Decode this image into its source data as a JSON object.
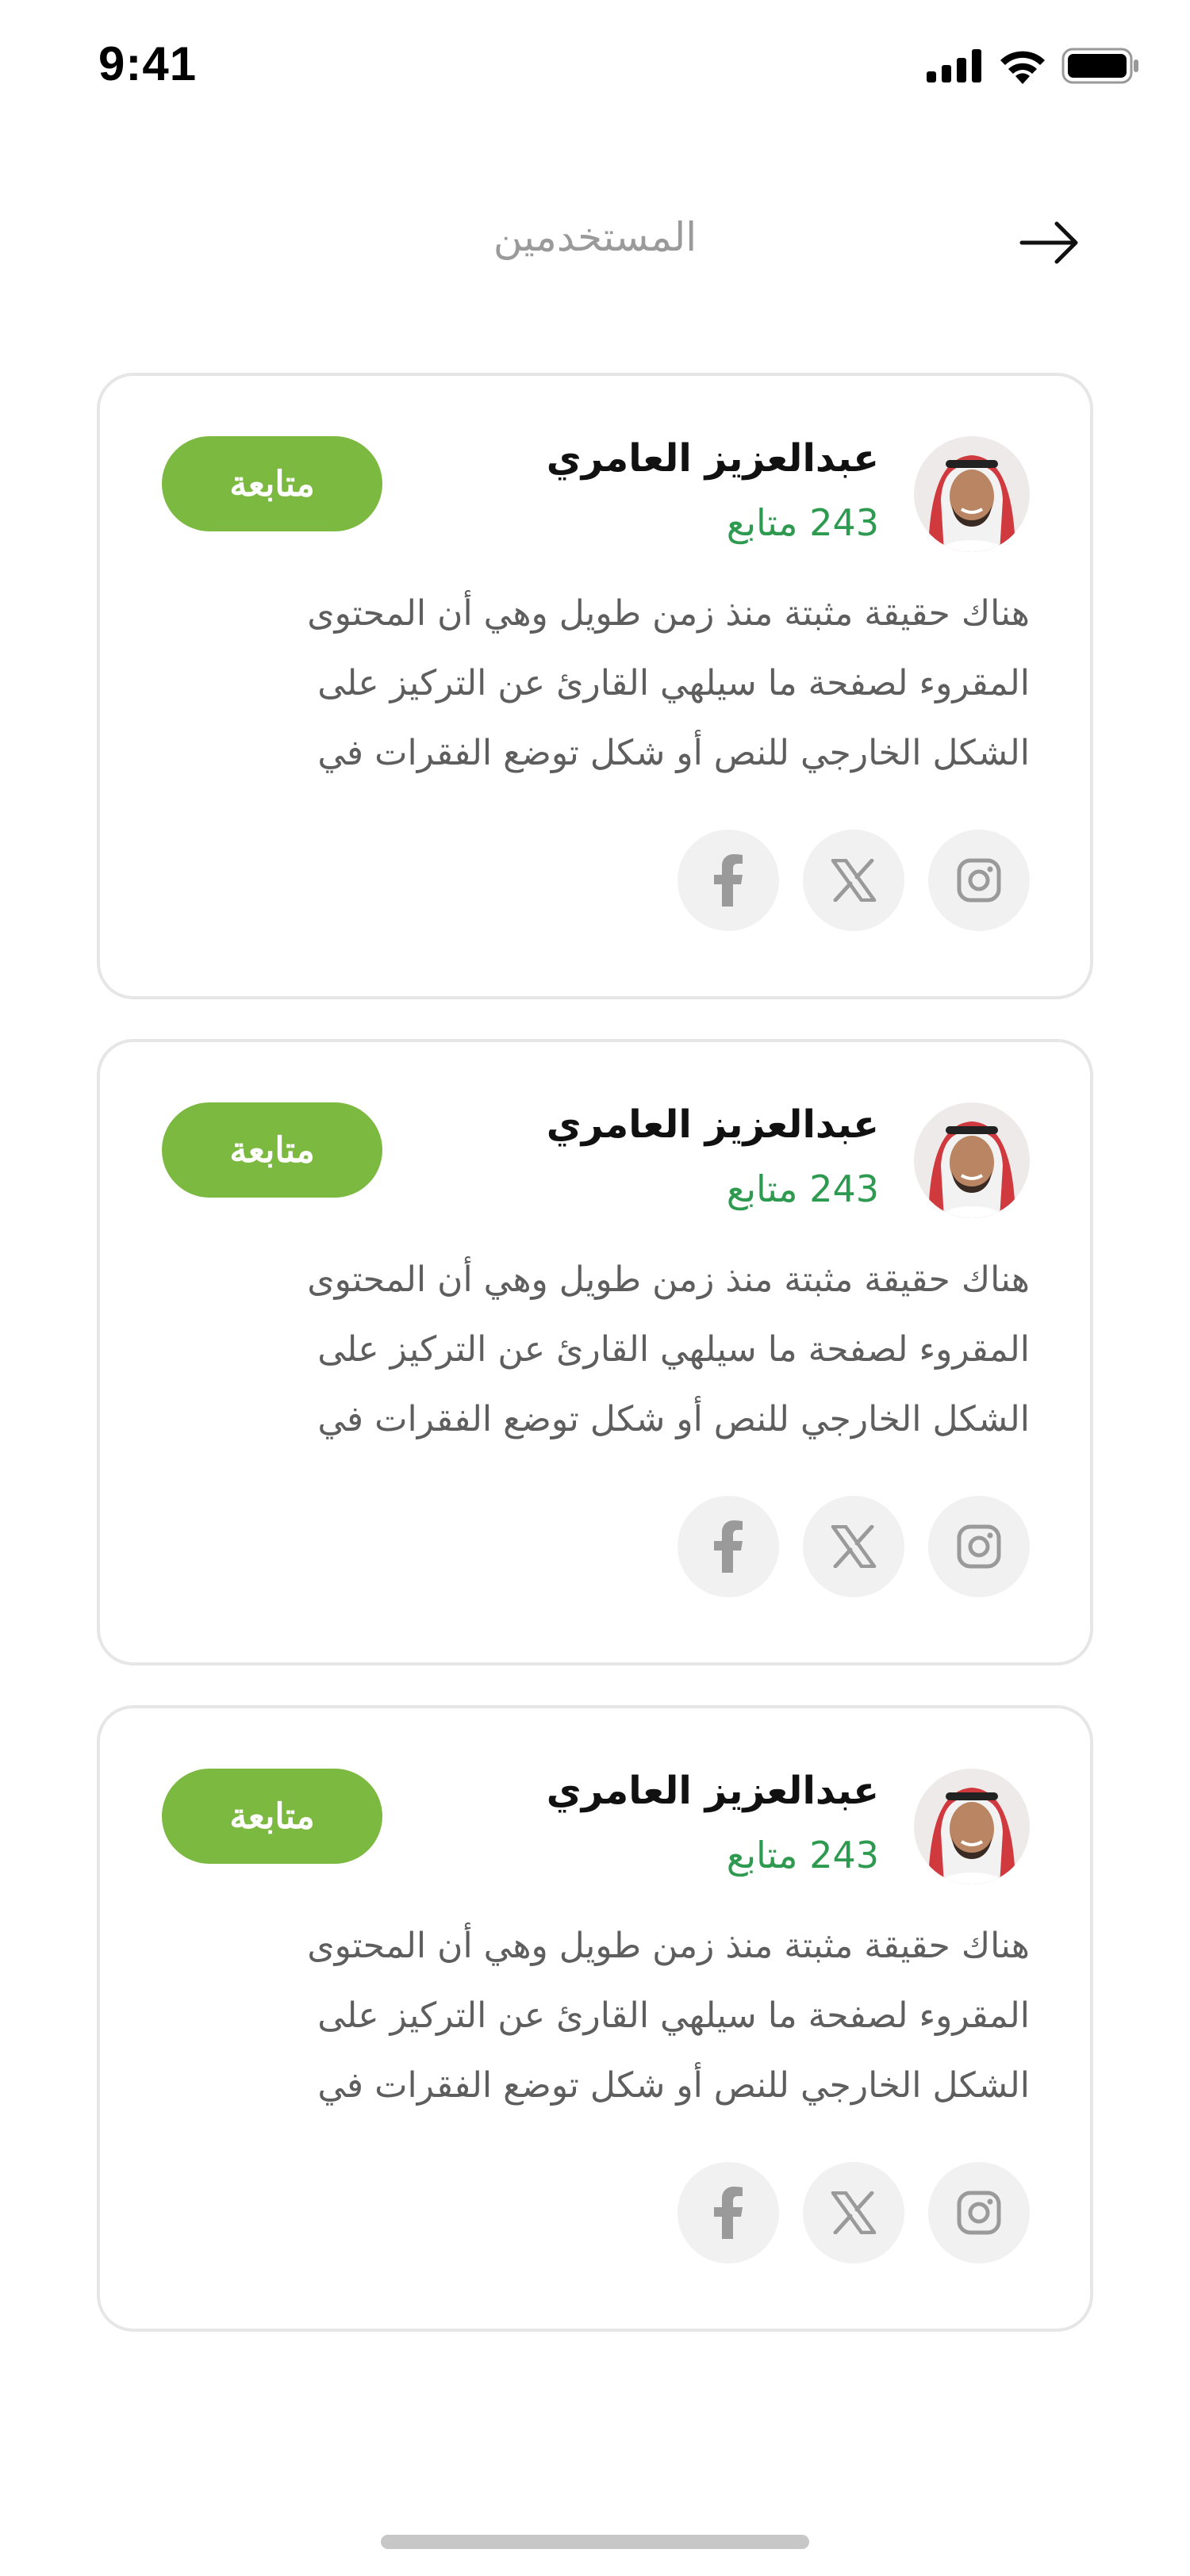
{
  "status_bar": {
    "time": "9:41"
  },
  "header": {
    "title": "المستخدمين"
  },
  "cards": [
    {
      "name": "عبدالعزيز العامري",
      "followers": "243 متابع",
      "follow_label": "متابعة",
      "bio_lines": [
        "هناك حقيقة مثبتة منذ زمن طويل وهي أن المحتوى",
        "المقروء لصفحة ما سيلهي القارئ عن التركيز على",
        "الشكل الخارجي للنص أو شكل توضع الفقرات في"
      ],
      "socials": [
        "instagram-icon",
        "x-icon",
        "facebook-icon"
      ]
    },
    {
      "name": "عبدالعزيز العامري",
      "followers": "243 متابع",
      "follow_label": "متابعة",
      "bio_lines": [
        "هناك حقيقة مثبتة منذ زمن طويل وهي أن المحتوى",
        "المقروء لصفحة ما سيلهي القارئ عن التركيز على",
        "الشكل الخارجي للنص أو شكل توضع الفقرات في"
      ],
      "socials": [
        "instagram-icon",
        "x-icon",
        "facebook-icon"
      ]
    },
    {
      "name": "عبدالعزيز العامري",
      "followers": "243 متابع",
      "follow_label": "متابعة",
      "bio_lines": [
        "هناك حقيقة مثبتة منذ زمن طويل وهي أن المحتوى",
        "المقروء لصفحة ما سيلهي القارئ عن التركيز على",
        "الشكل الخارجي للنص أو شكل توضع الفقرات في"
      ],
      "socials": [
        "instagram-icon",
        "x-icon",
        "facebook-icon"
      ]
    }
  ],
  "colors": {
    "accent": "#7cb940",
    "followers_text": "#2e9a4f",
    "title_text": "#9a9a9a",
    "bio_text": "#5e5e5e",
    "card_border": "#e6e6e6",
    "social_bg": "#f1f1f1"
  }
}
